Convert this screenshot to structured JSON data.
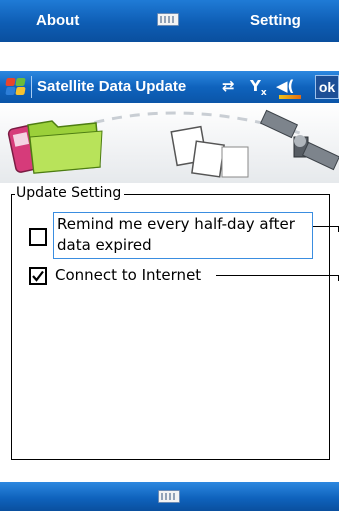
{
  "softkeys_top": {
    "left_label": "About",
    "right_label": "Setting",
    "center_icon": "keyboard-icon"
  },
  "titlebar": {
    "start_icon": "windows-start-icon",
    "title": "Satellite Data Update",
    "status_icons": [
      "sync-icon",
      "signal-icon",
      "volume-icon"
    ],
    "ok_label": "ok"
  },
  "banner": {
    "icons": [
      "phone-icon",
      "folder-icon",
      "document-icon",
      "satellite-icon"
    ]
  },
  "group": {
    "legend": "Update Setting",
    "options": [
      {
        "label": "Remind me every half-day after data expired",
        "checked": false
      },
      {
        "label": "Connect to Internet",
        "checked": true
      }
    ]
  },
  "softkeys_bottom": {
    "center_icon": "keyboard-icon"
  },
  "colors": {
    "bar_blue": "#0f63bd",
    "focus_border": "#3a8de0",
    "volume_accent": "#f0c419"
  }
}
